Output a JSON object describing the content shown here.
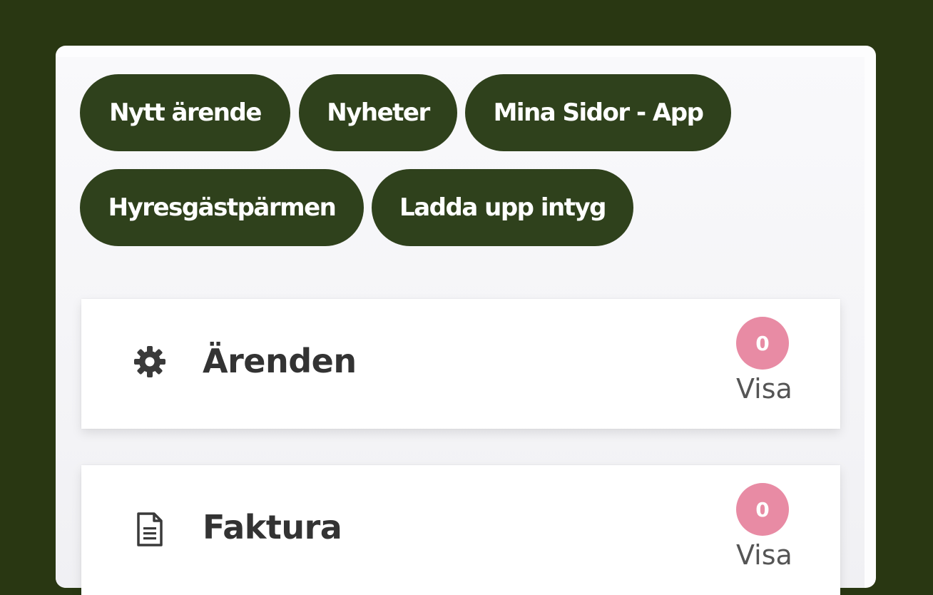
{
  "quick_links": [
    {
      "label": "Nytt ärende"
    },
    {
      "label": "Nyheter"
    },
    {
      "label": "Mina Sidor - App"
    },
    {
      "label": "Hyresgästpärmen"
    },
    {
      "label": "Ladda upp intyg"
    }
  ],
  "cards": [
    {
      "title": "Ärenden",
      "icon": "gear-icon",
      "count": "0",
      "action_label": "Visa"
    },
    {
      "title": "Faktura",
      "icon": "document-icon",
      "count": "0",
      "action_label": "Visa"
    }
  ],
  "colors": {
    "page_background": "#293712",
    "pill_background": "#2f411c",
    "badge_background": "#e88ba4",
    "card_text": "#333333"
  }
}
